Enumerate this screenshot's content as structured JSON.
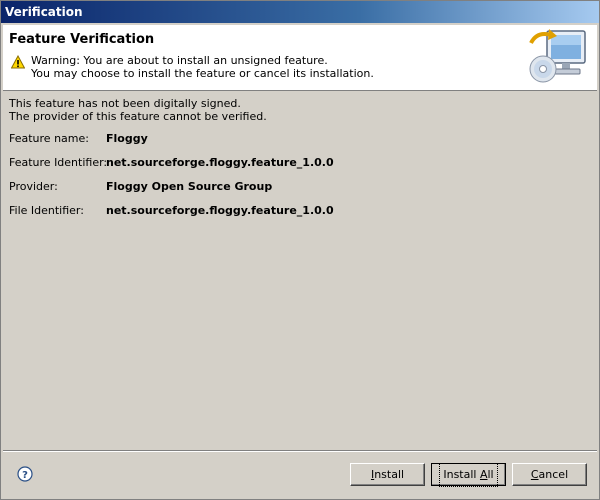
{
  "window": {
    "title": "Verification"
  },
  "banner": {
    "title": "Feature Verification",
    "warning_line1": "Warning: You are about to install an unsigned feature.",
    "warning_line2": "You may choose to install the feature or cancel its installation."
  },
  "notice": {
    "line1": "This feature has not been digitally signed.",
    "line2": "The provider of this feature cannot be verified."
  },
  "fields": [
    {
      "label": "Feature name:",
      "value": "Floggy"
    },
    {
      "label": "Feature Identifier:",
      "value": "net.sourceforge.floggy.feature_1.0.0"
    },
    {
      "label": "Provider:",
      "value": "Floggy Open Source Group"
    },
    {
      "label": "File Identifier:",
      "value": "net.sourceforge.floggy.feature_1.0.0"
    }
  ],
  "buttons": {
    "install_mnemonic": "I",
    "install_rest": "nstall",
    "install_all_pre": "Install ",
    "install_all_mnemonic": "A",
    "install_all_rest": "ll",
    "cancel_mnemonic": "C",
    "cancel_rest": "ancel"
  },
  "icons": {
    "warning": "warning-icon",
    "help": "help-icon",
    "banner_art": "install-computer-cd-icon"
  },
  "colors": {
    "titlebar_start": "#0a246a",
    "titlebar_end": "#a6caf0",
    "dialog_bg": "#d4d0c8"
  }
}
